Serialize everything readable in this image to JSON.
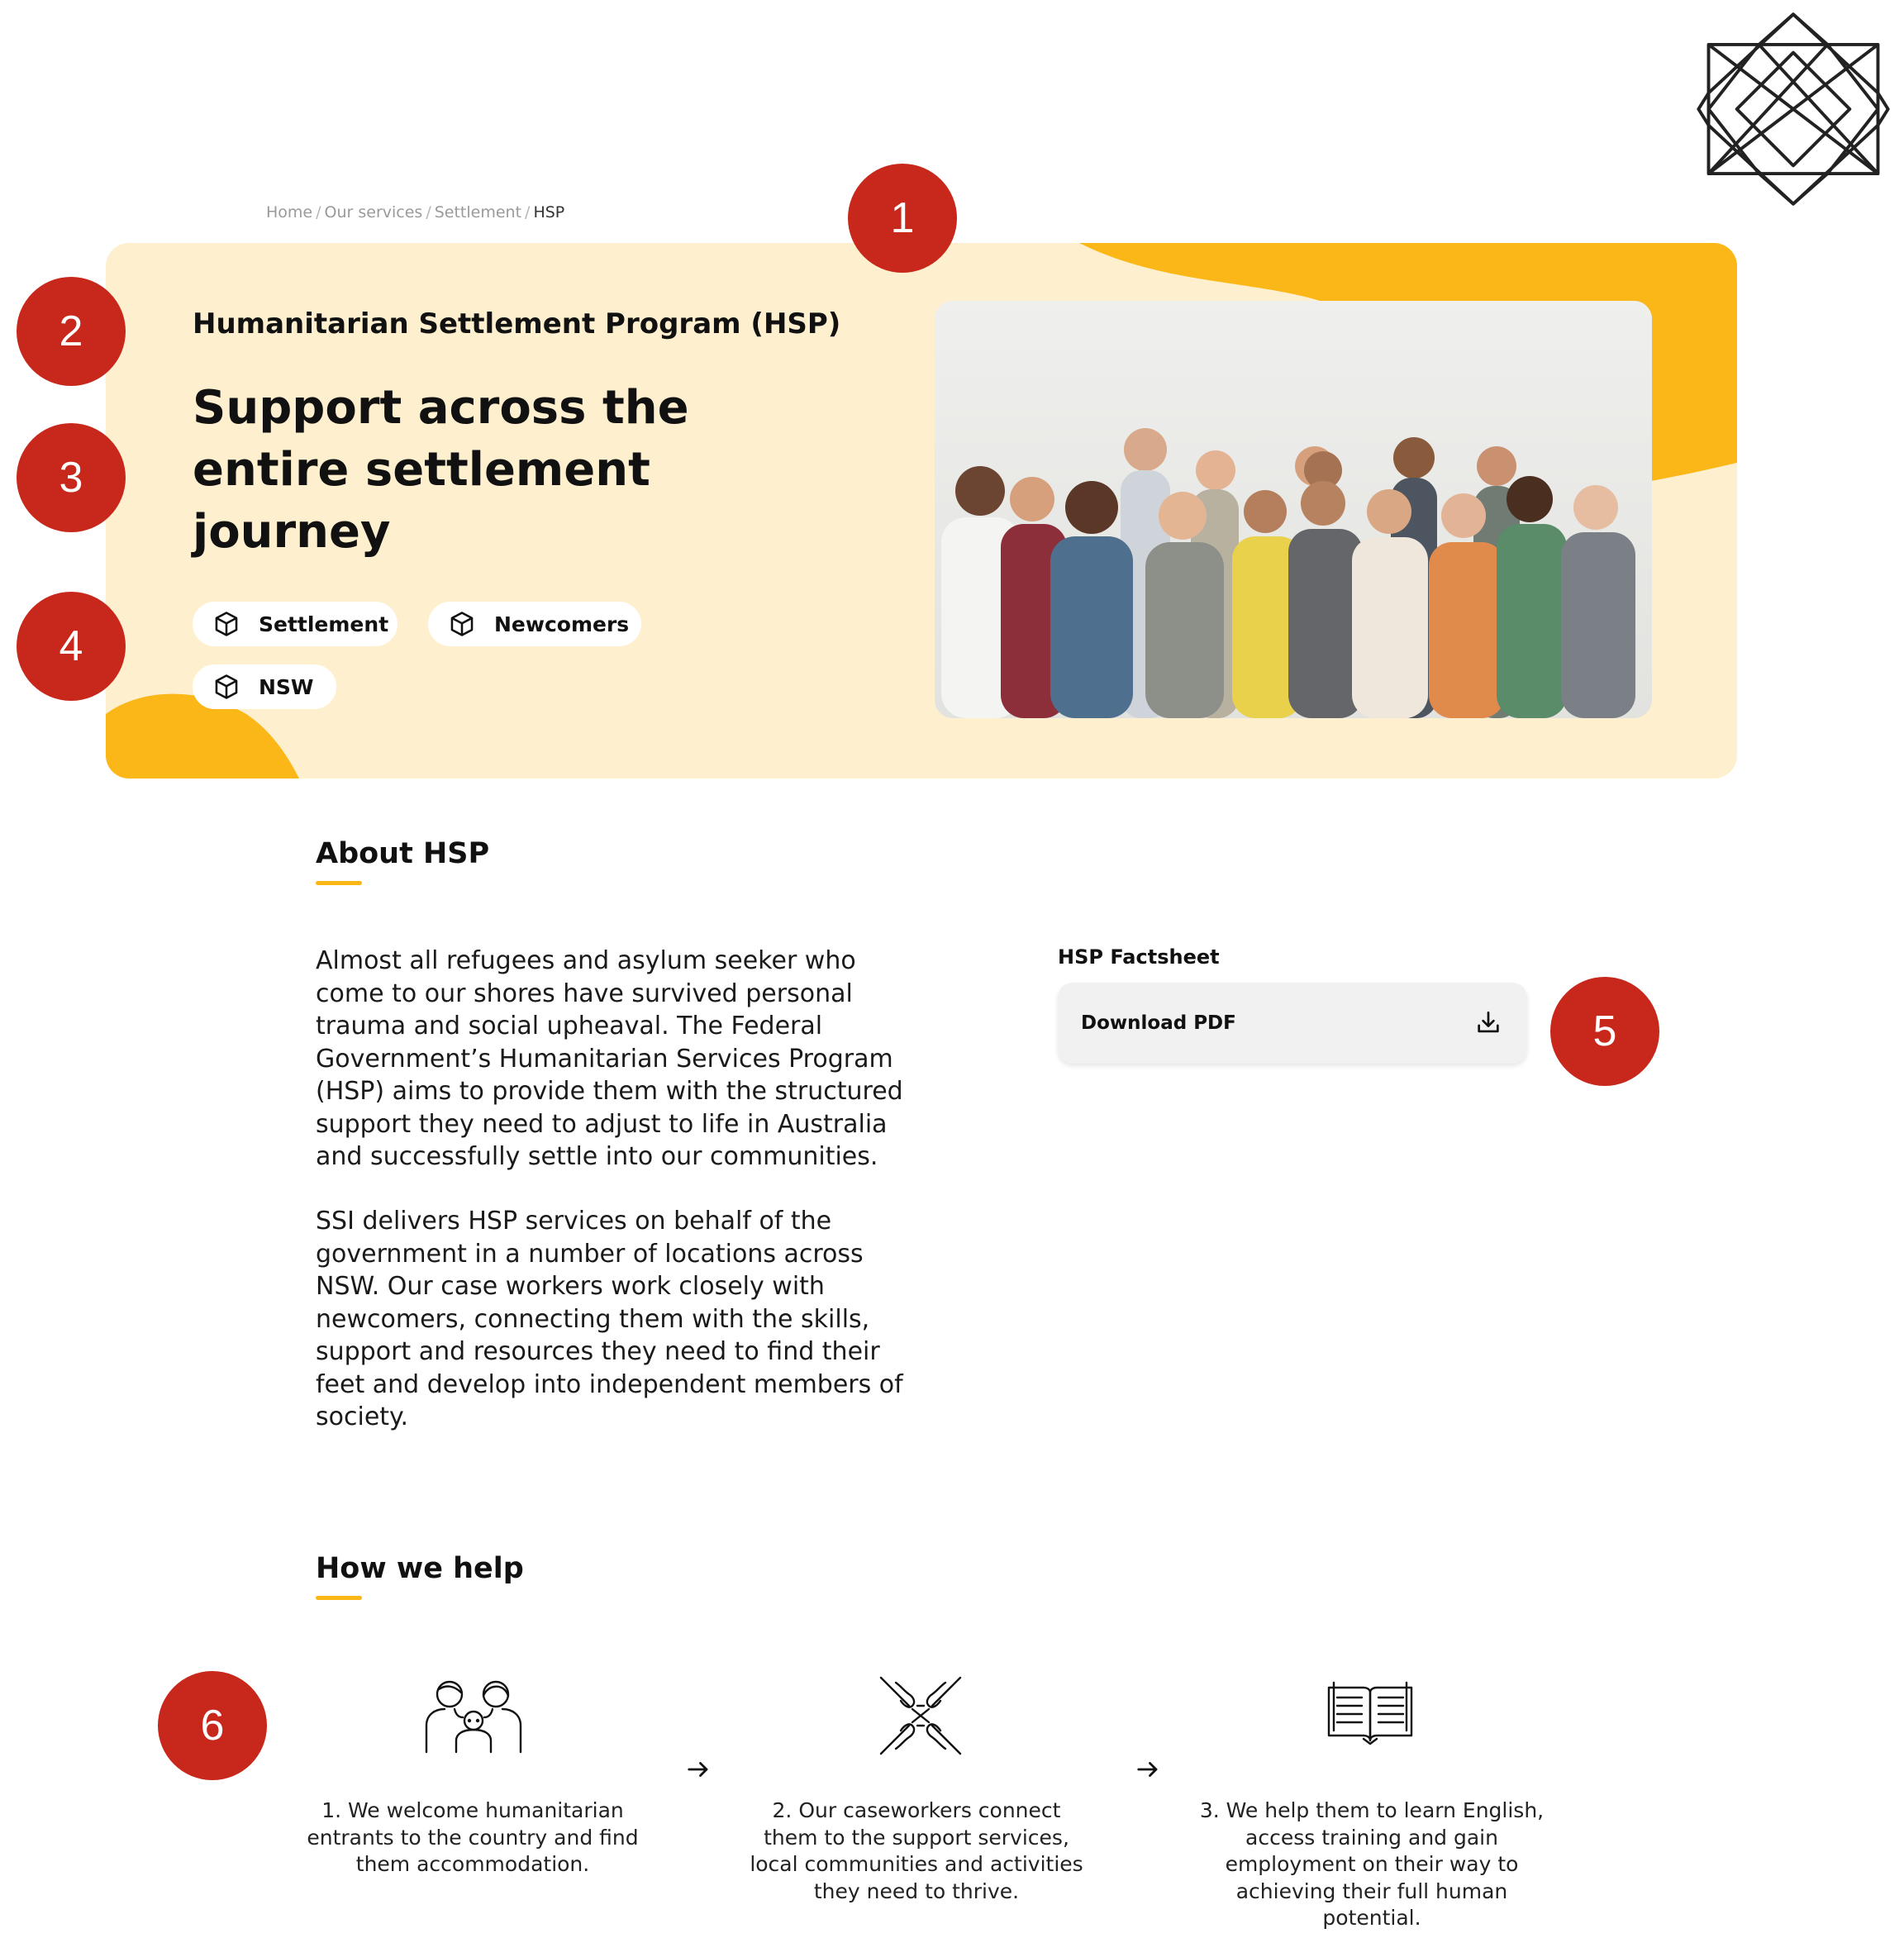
{
  "logo": {
    "icon": "star-lattice-logo"
  },
  "breadcrumb": {
    "items": [
      "Home",
      "Our services",
      "Settlement",
      "HSP"
    ],
    "separator": "/"
  },
  "hero": {
    "program": "Humanitarian Settlement Program (HSP)",
    "title": "Support across the entire settlement journey",
    "tags": [
      {
        "label": "Settlement",
        "icon": "cube-icon"
      },
      {
        "label": "Newcomers",
        "icon": "cube-icon"
      },
      {
        "label": "NSW",
        "icon": "cube-icon"
      }
    ],
    "photo_icon": "group-photo",
    "background": "#FEF0CF",
    "accent": "#FBB717"
  },
  "markers": [
    "1",
    "2",
    "3",
    "4",
    "5",
    "6"
  ],
  "about": {
    "heading": "About HSP",
    "paragraphs": [
      "Almost all refugees and asylum seeker who come to our shores have survived personal trauma and social upheaval. The Federal Government’s Humanitarian Services Program (HSP) aims to provide them with the structured support they need to adjust to life in Australia and successfully settle into our communities.",
      "SSI delivers HSP services on behalf of the government in a number of locations across NSW. Our case workers work closely with newcomers, connecting them with the skills, support and resources they need to find their feet and develop into independent members of society."
    ]
  },
  "factsheet": {
    "label": "HSP Factsheet",
    "button": "Download PDF",
    "icon": "download-icon"
  },
  "how": {
    "heading": "How we help",
    "steps": [
      {
        "icon": "family-icon",
        "text": "1. We welcome humanitarian entrants to the country and find them accommodation."
      },
      {
        "icon": "joined-hands-icon",
        "text": "2. Our caseworkers connect them to the support services, local communities and activities they need to thrive."
      },
      {
        "icon": "open-book-icon",
        "text": "3. We help them to learn English, access training and gain employment on their way to achieving their full human potential."
      }
    ]
  },
  "colors": {
    "marker": "#C8281C",
    "accent": "#FBB717",
    "hero_bg": "#FEF0CF"
  }
}
